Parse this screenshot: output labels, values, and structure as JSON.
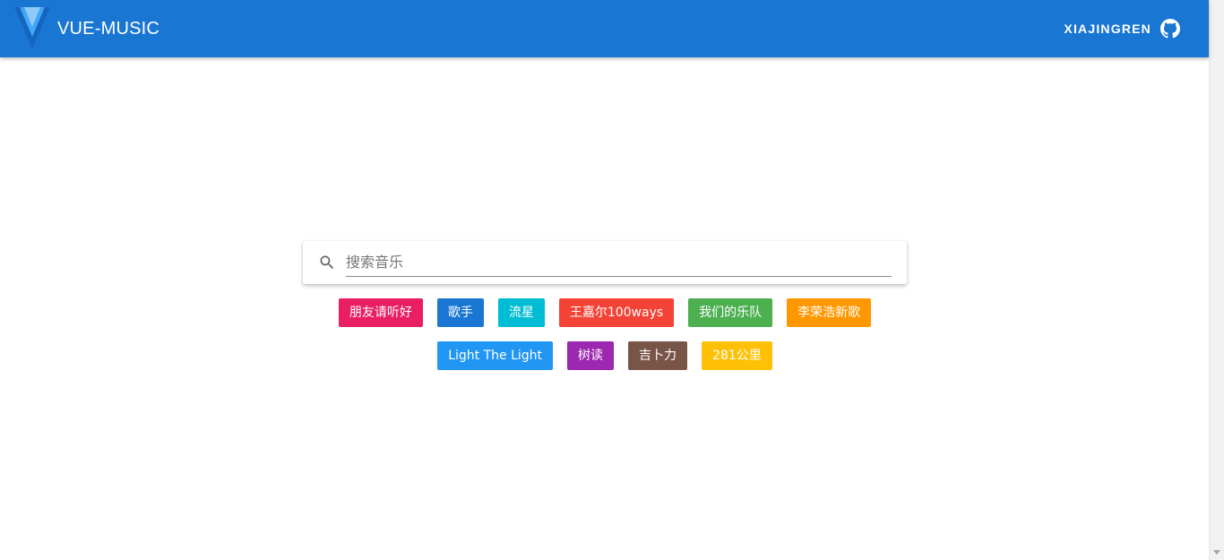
{
  "header": {
    "title": "VUE-MUSIC",
    "user": "XIAJINGREN",
    "logo_icon": "vue-logo-icon",
    "github_icon": "github-icon",
    "bg_color": "#1976d2"
  },
  "search": {
    "placeholder": "搜索音乐",
    "value": "",
    "icon": "search-icon"
  },
  "tags_row1": [
    {
      "label": "朋友请听好",
      "color": "#e91e63"
    },
    {
      "label": "歌手",
      "color": "#1976d2"
    },
    {
      "label": "流星",
      "color": "#00bcd4"
    },
    {
      "label": "王嘉尔100ways",
      "color": "#f44336"
    },
    {
      "label": "我们的乐队",
      "color": "#4caf50"
    },
    {
      "label": "李荣浩新歌",
      "color": "#ff9800"
    }
  ],
  "tags_row2": [
    {
      "label": "Light The Light",
      "color": "#2196f3"
    },
    {
      "label": "树读",
      "color": "#9c27b0"
    },
    {
      "label": "吉卜力",
      "color": "#795548"
    },
    {
      "label": "281公里",
      "color": "#ffc107"
    }
  ]
}
